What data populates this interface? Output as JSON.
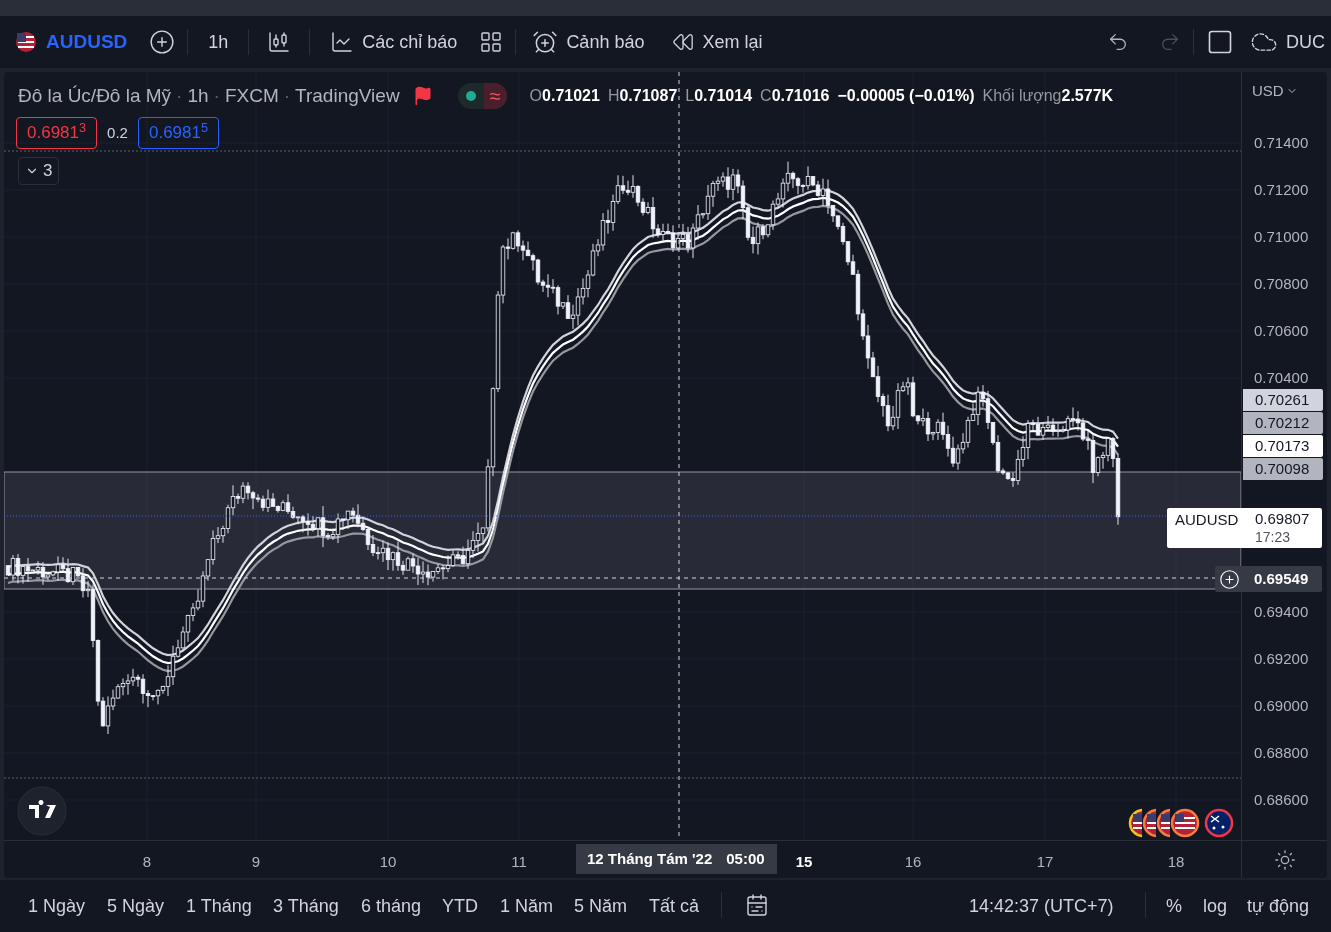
{
  "toolbar": {
    "symbol": "AUDUSD",
    "interval": "1h",
    "indicators": "Các chỉ báo",
    "alerts": "Cảnh báo",
    "replay": "Xem lại",
    "account": "DUC"
  },
  "legend": {
    "title": "Đô la Úc/Đô la Mỹ",
    "interval": "1h",
    "exchange": "FXCM",
    "source": "TradingView",
    "separator": "·",
    "toggle_symbol": "≈",
    "ohlc": [
      {
        "label": "O",
        "value": "0.71021"
      },
      {
        "label": "H",
        "value": "0.71087"
      },
      {
        "label": "L",
        "value": "0.71014"
      },
      {
        "label": "C",
        "value": "0.71016"
      }
    ],
    "change": "−0.00005 (−0.01%)",
    "volume_label": "Khối lượng",
    "volume": "2.577K"
  },
  "quote": {
    "sell": "0.6981$^{3}$",
    "spread": "0.2",
    "buy": "0.6981$^{5}$"
  },
  "indicators_count": "3",
  "price_axis": {
    "currency": "USD",
    "ticks": [
      "0.71400",
      "0.71200",
      "0.71000",
      "0.70800",
      "0.70600",
      "0.70400",
      "0.69400",
      "0.69200",
      "0.69000",
      "0.68800",
      "0.68600"
    ],
    "labels": [
      {
        "value": "0.70261",
        "color": "#d1d4dc"
      },
      {
        "value": "0.70212",
        "color": "#b2b5be"
      },
      {
        "value": "0.70173",
        "color": "#ffffff"
      },
      {
        "value": "0.70098",
        "color": "#b2b5be"
      }
    ],
    "last_price": {
      "symbol": "AUDUSD",
      "value": "0.69807",
      "countdown": "17:23"
    },
    "crosshair": "0.69549"
  },
  "time_axis": {
    "ticks": [
      {
        "label": "8",
        "bold": false
      },
      {
        "label": "9",
        "bold": false
      },
      {
        "label": "10",
        "bold": false
      },
      {
        "label": "11",
        "bold": false
      },
      {
        "label": "15",
        "bold": true
      },
      {
        "label": "16",
        "bold": false
      },
      {
        "label": "17",
        "bold": false
      },
      {
        "label": "18",
        "bold": false
      }
    ],
    "crosshair": {
      "date": "12 Tháng Tám '22",
      "time": "05:00"
    }
  },
  "bottom_bar": {
    "ranges": [
      "1 Ngày",
      "5 Ngày",
      "1 Tháng",
      "3 Tháng",
      "6 tháng",
      "YTD",
      "1 Năm",
      "5 Năm",
      "Tất cả"
    ],
    "clock": "14:42:37 (UTC+7)",
    "options": [
      "%",
      "log",
      "tự động"
    ]
  }
}
